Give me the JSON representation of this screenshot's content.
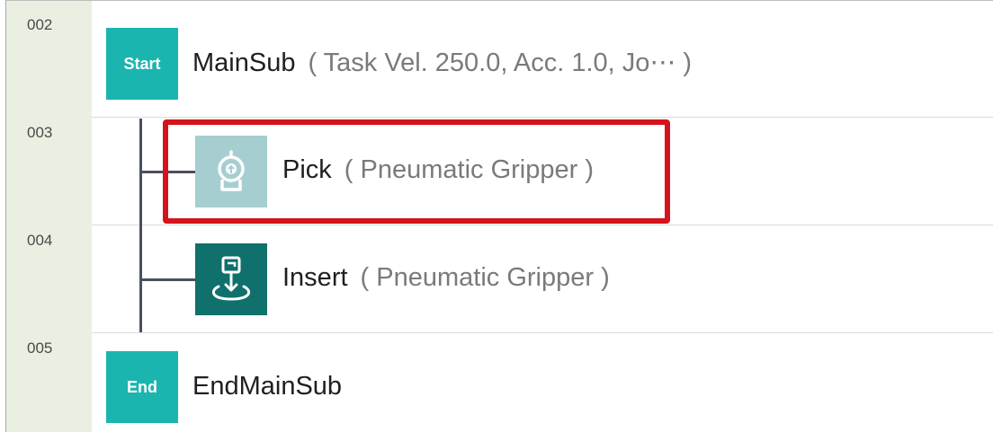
{
  "program": {
    "lines": [
      {
        "number": "002",
        "tile": "Start",
        "command": "MainSub",
        "params": "( Task Vel. 250.0, Acc. 1.0, Jo⋯ )"
      },
      {
        "number": "003",
        "icon": "gripper-icon",
        "command": "Pick",
        "params": "( Pneumatic Gripper )",
        "highlighted": true
      },
      {
        "number": "004",
        "icon": "insert-icon",
        "command": "Insert",
        "params": "( Pneumatic Gripper )"
      },
      {
        "number": "005",
        "tile": "End",
        "command": "EndMainSub",
        "params": ""
      }
    ]
  },
  "colors": {
    "gutter": "#e9f0e1",
    "tile_teal": "#1bb5b0",
    "tile_pale": "#a6ced0",
    "tile_dark": "#10706b",
    "highlight": "#d4141c"
  }
}
